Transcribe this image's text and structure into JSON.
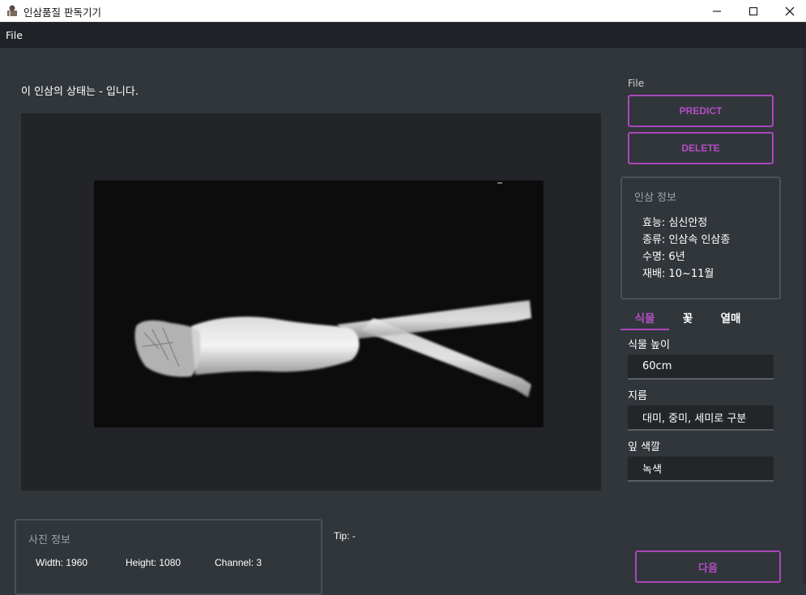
{
  "window": {
    "title": "인삼품질 판독기기"
  },
  "menu": {
    "file_label": "File"
  },
  "status": {
    "text": "이 인삼의 상태는 - 입니다."
  },
  "side": {
    "file_label": "File",
    "predict_label": "PREDICT",
    "delete_label": "DELETE"
  },
  "ginseng_info": {
    "title": "인삼 정보",
    "lines": [
      "효능: 심신안정",
      "종류: 인삼속 인삼종",
      "수명: 6년",
      "재배: 10~11월"
    ]
  },
  "tabs": [
    {
      "label": "식물"
    },
    {
      "label": "꽃"
    },
    {
      "label": "열매"
    }
  ],
  "plant_fields": [
    {
      "label": "식물 높이",
      "value": "60cm"
    },
    {
      "label": "지름",
      "value": "대미, 중미, 세미로 구분"
    },
    {
      "label": "잎 색깔",
      "value": "녹색"
    }
  ],
  "photo_info": {
    "title": "사진 정보",
    "width": "Width: 1960",
    "height": "Height: 1080",
    "channel": "Channel: 3"
  },
  "tip": "Tip: -",
  "next_label": "다음",
  "colors": {
    "accent": "#ab47bc",
    "background": "#31363b",
    "menubar": "#1f2226",
    "panel": "#232427"
  }
}
